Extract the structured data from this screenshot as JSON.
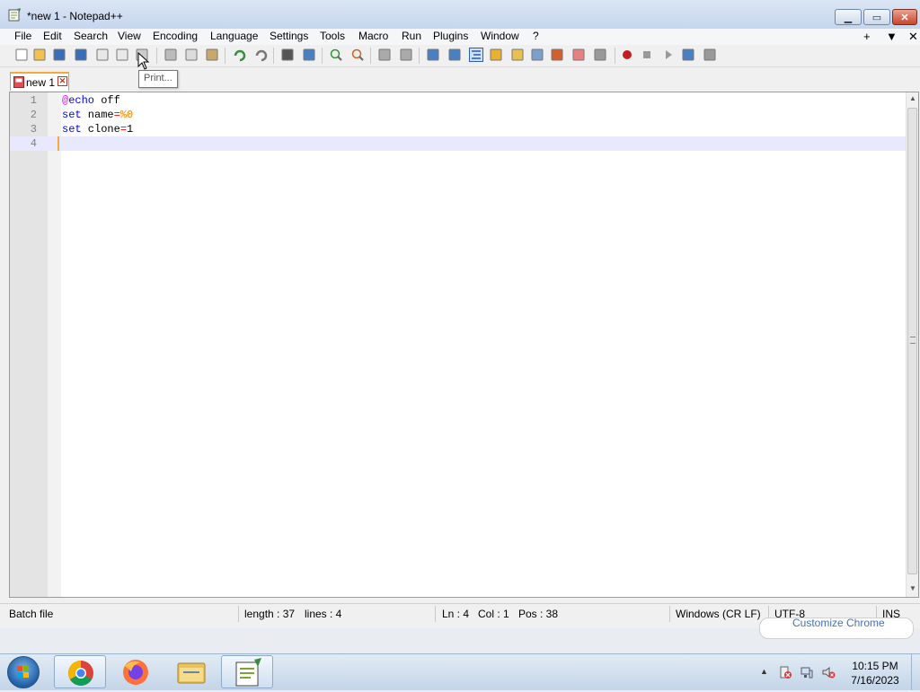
{
  "window": {
    "title": "*new 1 - Notepad++",
    "controls": {
      "minimize": "▁",
      "maximize": "▭",
      "close": "✕"
    }
  },
  "menu": {
    "items": [
      "File",
      "Edit",
      "Search",
      "View",
      "Encoding",
      "Language",
      "Settings",
      "Tools",
      "Macro",
      "Run",
      "Plugins",
      "Window",
      "?"
    ],
    "right": {
      "plus": "+",
      "dropdown": "▼",
      "close": "✕"
    }
  },
  "toolbar": {
    "tooltip": "Print...",
    "icons": [
      "new-file-icon",
      "open-file-icon",
      "save-icon",
      "save-all-icon",
      "close-icon",
      "close-all-icon",
      "print-icon",
      "cut-icon",
      "copy-icon",
      "paste-icon",
      "undo-icon",
      "redo-icon",
      "find-icon",
      "replace-icon",
      "zoom-in-icon",
      "zoom-out-icon",
      "sync-vertical-icon",
      "sync-horizontal-icon",
      "word-wrap-icon",
      "show-all-chars-icon",
      "indent-guide-icon",
      "udl-icon",
      "doc-map-icon",
      "doc-list-icon",
      "function-list-icon",
      "folder-workspace-icon",
      "monitoring-icon",
      "record-macro-icon",
      "stop-macro-icon",
      "play-macro-icon",
      "run-multiple-macro-icon",
      "save-macro-icon"
    ]
  },
  "tabs": [
    {
      "label": "new 1",
      "close": "✕"
    }
  ],
  "editor": {
    "lines": [
      {
        "number": "1",
        "parts": [
          {
            "t": "@",
            "c": "at"
          },
          {
            "t": "echo",
            "c": "kw"
          },
          {
            "t": " off",
            "c": ""
          }
        ]
      },
      {
        "number": "2",
        "parts": [
          {
            "t": "set",
            "c": "kw"
          },
          {
            "t": " name",
            "c": ""
          },
          {
            "t": "=",
            "c": "op"
          },
          {
            "t": "%0",
            "c": "var"
          }
        ]
      },
      {
        "number": "3",
        "parts": [
          {
            "t": "set",
            "c": "kw"
          },
          {
            "t": " clone",
            "c": ""
          },
          {
            "t": "=",
            "c": "op"
          },
          {
            "t": "1",
            "c": ""
          }
        ]
      },
      {
        "number": "4",
        "parts": []
      }
    ],
    "current_line": 4
  },
  "status": {
    "language": "Batch file",
    "length": "length : 37",
    "lines": "lines : 4",
    "ln": "Ln : 4",
    "col": "Col : 1",
    "pos": "Pos : 38",
    "eol": "Windows (CR LF)",
    "encoding": "UTF-8",
    "mode": "INS"
  },
  "background_popup": {
    "text": "Customize Chrome"
  },
  "taskbar": {
    "apps": [
      "chrome-icon",
      "firefox-icon",
      "file-explorer-icon",
      "notepadpp-icon"
    ],
    "clock": {
      "time": "10:15 PM",
      "date": "7/16/2023"
    },
    "tray_arrow": "▲"
  },
  "colors": {
    "accent": "#f4a93a",
    "keyword": "#0000ff",
    "at": "#ff00ff",
    "variable": "#ff8000",
    "operator": "#ff0000"
  }
}
